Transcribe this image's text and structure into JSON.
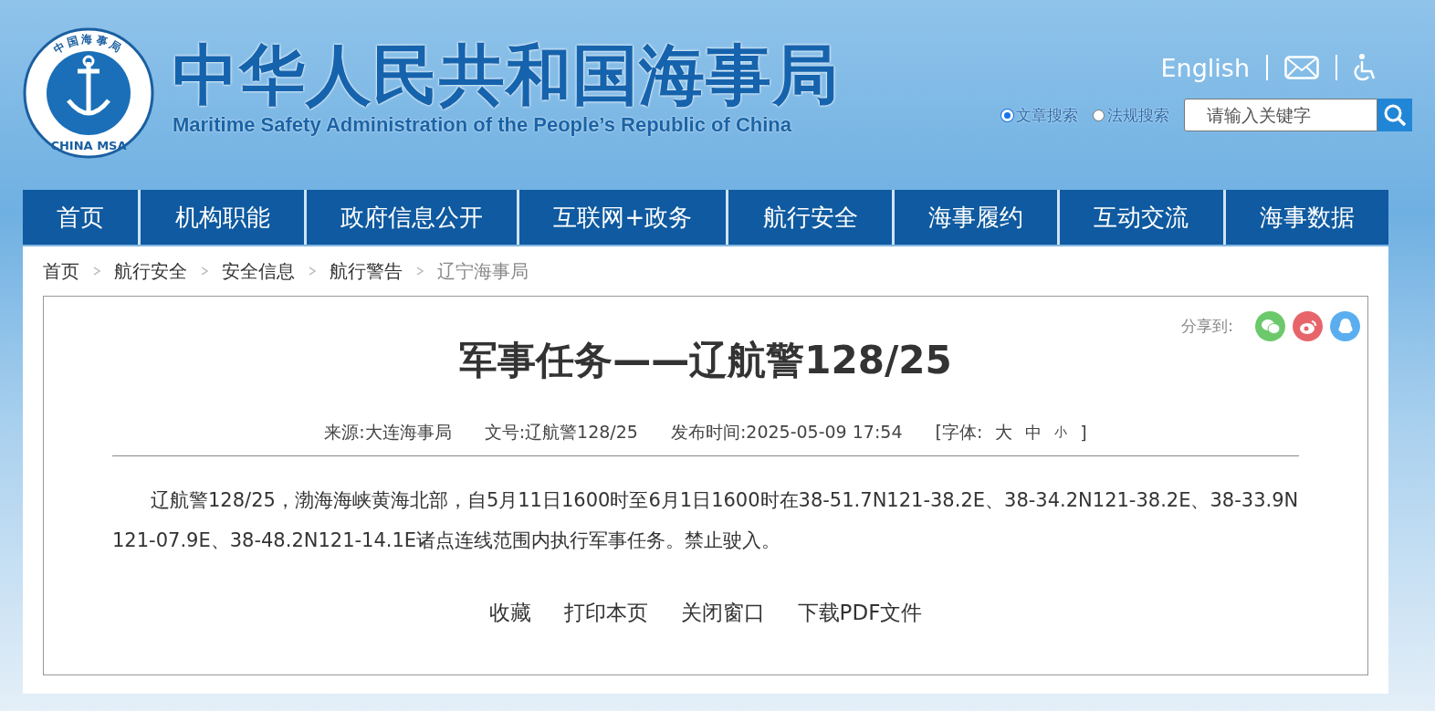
{
  "header": {
    "logo": {
      "ring_text": "中国海事局",
      "bottom_text": "CHINA MSA"
    },
    "title": "中华人民共和国海事局",
    "subtitle": "Maritime Safety Administration of the People’s Republic of China",
    "language_link": "English",
    "search_scopes": [
      {
        "label": "文章搜索",
        "selected": true
      },
      {
        "label": "法规搜索",
        "selected": false
      }
    ],
    "search": {
      "placeholder": "请输入关键字"
    }
  },
  "nav": [
    {
      "label": "首页"
    },
    {
      "label": "机构职能"
    },
    {
      "label": "政府信息公开"
    },
    {
      "label": "互联网+政务"
    },
    {
      "label": "航行安全"
    },
    {
      "label": "海事履约"
    },
    {
      "label": "互动交流"
    },
    {
      "label": "海事数据"
    }
  ],
  "breadcrumb": [
    {
      "label": "首页",
      "current": false
    },
    {
      "label": "航行安全",
      "current": false
    },
    {
      "label": "安全信息",
      "current": false
    },
    {
      "label": "航行警告",
      "current": false
    },
    {
      "label": "辽宁海事局",
      "current": true
    }
  ],
  "article": {
    "share_label": "分享到:",
    "share_targets": [
      {
        "kind": "wechat",
        "color": "#6cc96b"
      },
      {
        "kind": "weibo",
        "color": "#e7656a"
      },
      {
        "kind": "qq",
        "color": "#5aaef0"
      }
    ],
    "title": "军事任务——辽航警128/25",
    "meta": [
      {
        "label": "来源:",
        "value": "大连海事局"
      },
      {
        "label": "文号:",
        "value": "辽航警128/25"
      },
      {
        "label": "发布时间:",
        "value": "2025-05-09 17:54"
      }
    ],
    "font_size": {
      "open": "[字体:",
      "sizes": [
        "大",
        "中",
        "小"
      ],
      "close": "]"
    },
    "body": "辽航警128/25，渤海海峡黄海北部，自5月11日1600时至6月1日1600时在38-51.7N121-38.2E、38-34.2N121-38.2E、38-33.9N121-07.9E、38-48.2N121-14.1E诸点连线范围内执行军事任务。禁止驶入。",
    "actions": [
      "收藏",
      "打印本页",
      "关闭窗口",
      "下载PDF文件"
    ]
  }
}
